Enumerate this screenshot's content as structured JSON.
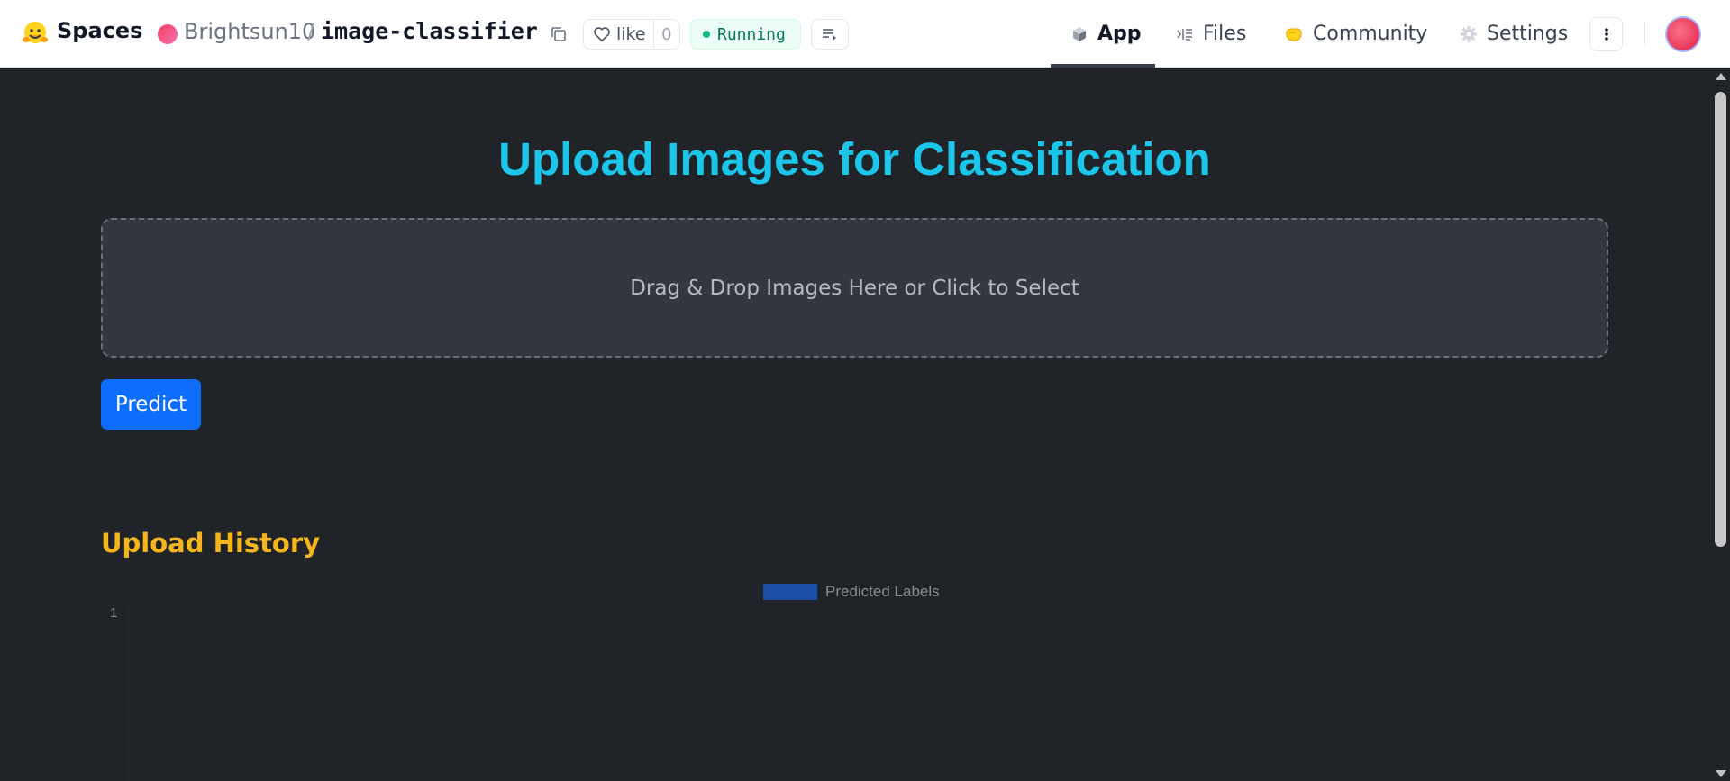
{
  "header": {
    "brand": "Spaces",
    "owner": "Brightsun10",
    "separator": "/",
    "repo": "image-classifier",
    "like_label": "like",
    "like_count": "0",
    "status": "Running",
    "tabs": [
      {
        "label": "App",
        "icon": "cube-icon",
        "active": true
      },
      {
        "label": "Files",
        "icon": "files-icon",
        "active": false
      },
      {
        "label": "Community",
        "icon": "community-icon",
        "active": false
      },
      {
        "label": "Settings",
        "icon": "gear-icon",
        "active": false
      }
    ]
  },
  "app": {
    "title": "Upload Images for Classification",
    "dropzone_text": "Drag & Drop Images Here or Click to Select",
    "predict_label": "Predict",
    "history_title": "Upload History"
  },
  "chart_data": {
    "type": "bar",
    "categories": [],
    "series": [
      {
        "name": "Predicted Labels",
        "values": [],
        "color": "#1c4ea8"
      }
    ],
    "y_ticks": [
      "1"
    ],
    "ylim": [
      0,
      1
    ],
    "legend": "top-center",
    "grid": false
  },
  "colors": {
    "title": "#1cc6ea",
    "history_title": "#f6b61a",
    "predict_button": "#0d6efd",
    "background": "#202327",
    "dropzone_bg": "#343740",
    "running_green": "#10b981"
  }
}
